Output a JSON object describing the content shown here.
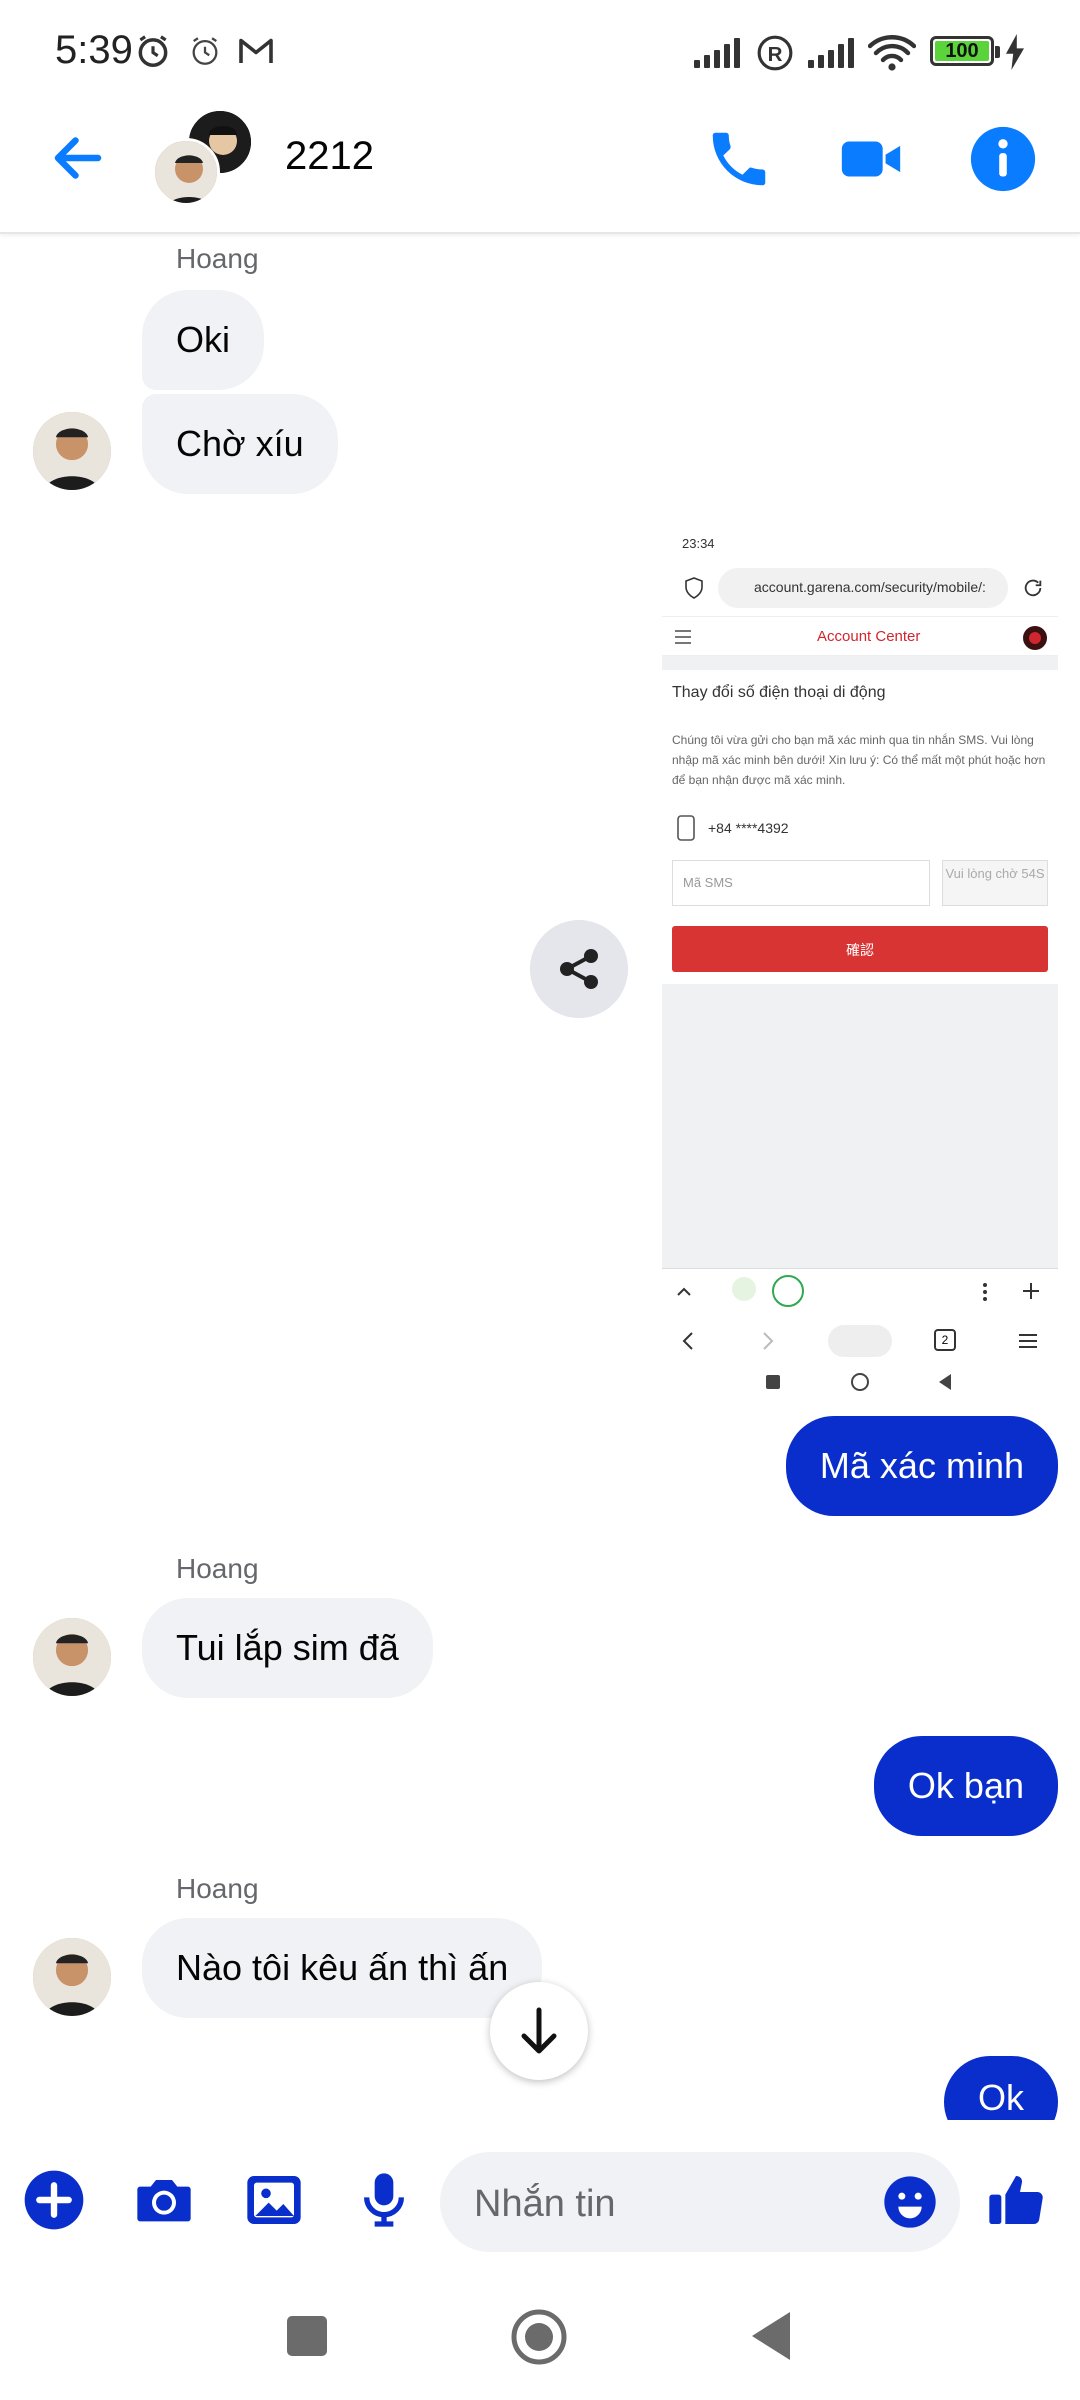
{
  "status_bar": {
    "time": "5:39",
    "battery": "100"
  },
  "header": {
    "title": "2212",
    "back_icon": "arrow-left-icon",
    "call_icon": "phone-icon",
    "video_icon": "video-camera-icon",
    "info_icon": "info-icon"
  },
  "messages": {
    "m1_sender": "Hoang",
    "m1_text": "Oki",
    "m2_text": "Chờ xíu",
    "m3_text": "Mã xác minh",
    "m4_sender": "Hoang",
    "m4_text": "Tui lắp sim đã",
    "m5_text": "Ok bạn",
    "m6_sender": "Hoang",
    "m6_text": "Nào tôi kêu ấn thì ấn",
    "m7_text": "Ok"
  },
  "shared_image": {
    "status_time": "23:34",
    "url": "account.garena.com/security/mobile/:",
    "brand": "Account Center",
    "title": "Thay đổi số điện thoại di động",
    "description": "Chúng tôi vừa gửi cho bạn mã xác minh qua tin nhắn SMS. Vui lòng nhập mã xác minh bên dưới! Xin lưu ý: Có thể mất một phút hoặc hơn để bạn nhận được mã xác minh.",
    "phone": "+84 ****4392",
    "sms_placeholder": "Mã SMS",
    "wait_text": "Vui lòng chờ 54S",
    "confirm_label": "確認",
    "tab_count": "2"
  },
  "composer": {
    "placeholder": "Nhắn tin"
  },
  "colors": {
    "accent": "#0a7cff",
    "outgoing_bubble": "#0a2ecb",
    "incoming_bubble": "#f0f2f5"
  }
}
